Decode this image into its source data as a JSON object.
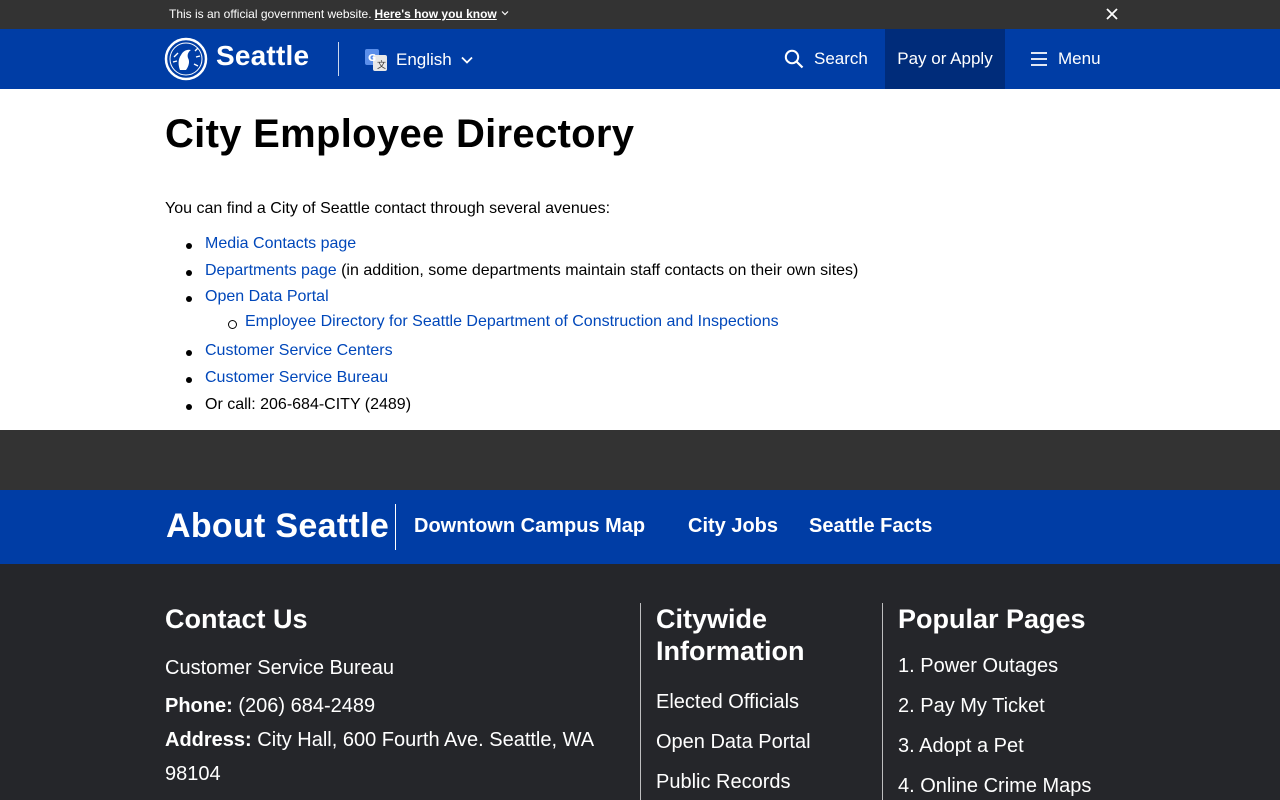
{
  "gov_banner": {
    "text": "This is an official government website.",
    "link": "Here's how you know",
    "chevron_icon": "chevron-down-icon",
    "close_icon": "close-icon"
  },
  "header": {
    "brand": "Seattle",
    "language": "English",
    "search": "Search",
    "pay_apply": "Pay or Apply",
    "menu": "Menu"
  },
  "main": {
    "title": "City Employee Directory",
    "intro": "You can find a City of Seattle contact through several avenues:",
    "items": [
      {
        "link": "Media Contacts page",
        "suffix": ""
      },
      {
        "link": "Departments page",
        "suffix": " (in addition, some departments maintain staff contacts on their own sites)"
      },
      {
        "link": "Open Data Portal",
        "suffix": ""
      },
      {
        "link": "Employee Directory for Seattle Department of Construction and Inspections",
        "suffix": "",
        "sub": true
      },
      {
        "link": "Customer Service Centers",
        "suffix": ""
      },
      {
        "link": "Customer Service Bureau",
        "suffix": ""
      },
      {
        "text": "Or call: 206-684-CITY (2489)"
      }
    ]
  },
  "about": {
    "title": "About Seattle",
    "links": [
      "Downtown Campus Map",
      "City Jobs",
      "Seattle Facts"
    ]
  },
  "footer": {
    "contact": {
      "heading": "Contact Us",
      "name": "Customer Service Bureau",
      "phone_label": "Phone:",
      "phone": "(206) 684-2489",
      "address_label": "Address:",
      "address_line1": "City Hall, 600 Fourth Ave. Seattle, WA",
      "address_line2": "98104"
    },
    "citywide": {
      "heading_line1": "Citywide",
      "heading_line2": "Information",
      "links": [
        "Elected Officials",
        "Open Data Portal",
        "Public Records"
      ]
    },
    "popular": {
      "heading": "Popular Pages",
      "links": [
        "1. Power Outages",
        "2. Pay My Ticket",
        "3. Adopt a Pet",
        "4. Online Crime Maps"
      ]
    }
  },
  "colors": {
    "brand_blue": "#003da5",
    "pay_blue": "#002c7a",
    "link_blue": "#0047ba",
    "banner_gray": "#333333",
    "footer_dark": "#25262a"
  }
}
